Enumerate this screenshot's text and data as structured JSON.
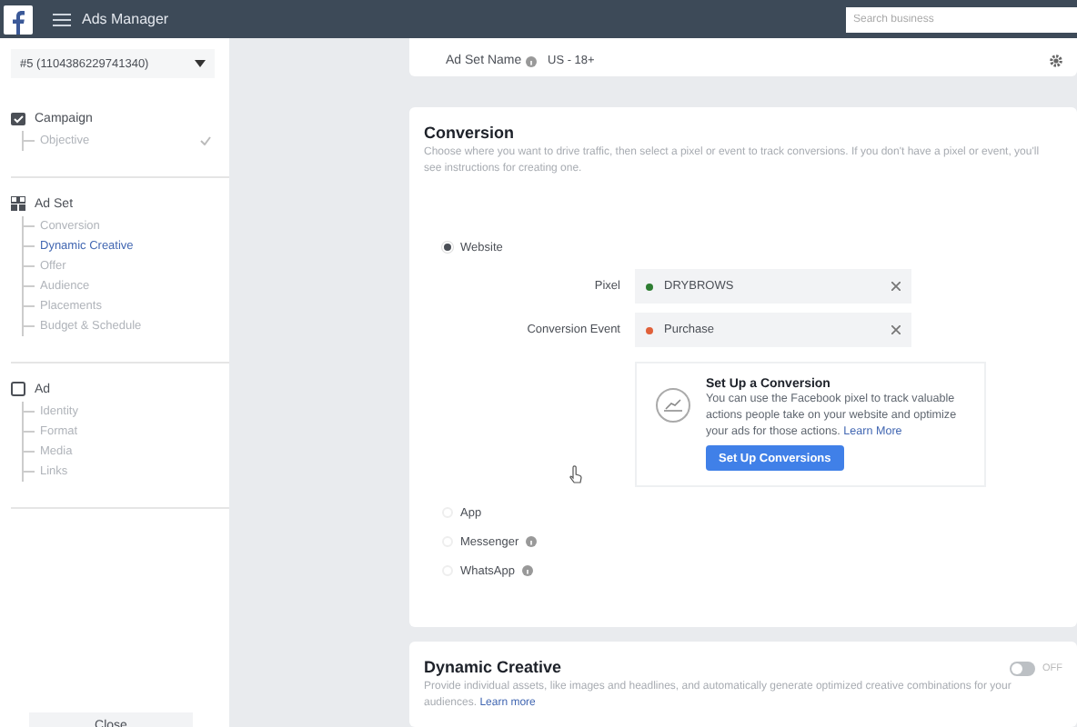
{
  "topbar": {
    "title": "Ads Manager",
    "search": {
      "placeholder": "Search business"
    }
  },
  "sidebar": {
    "account": "#5 (1104386229741340)",
    "sections": [
      {
        "kind": "campaign",
        "label": "Campaign",
        "children": [
          {
            "label": "Objective",
            "selected": false,
            "done": true
          }
        ]
      },
      {
        "kind": "adset",
        "label": "Ad Set",
        "children": [
          {
            "label": "Conversion",
            "selected": false,
            "done": false
          },
          {
            "label": "Dynamic Creative",
            "selected": true,
            "done": false
          },
          {
            "label": "Offer",
            "selected": false,
            "done": false
          },
          {
            "label": "Audience",
            "selected": false,
            "done": false
          },
          {
            "label": "Placements",
            "selected": false,
            "done": false
          },
          {
            "label": "Budget & Schedule",
            "selected": false,
            "done": false
          }
        ]
      },
      {
        "kind": "ad",
        "label": "Ad",
        "children": [
          {
            "label": "Identity",
            "selected": false,
            "done": false
          },
          {
            "label": "Format",
            "selected": false,
            "done": false
          },
          {
            "label": "Media",
            "selected": false,
            "done": false
          },
          {
            "label": "Links",
            "selected": false,
            "done": false
          }
        ]
      }
    ],
    "close": "Close"
  },
  "ad_set_name": {
    "label": "Ad Set Name",
    "value": "US - 18+"
  },
  "conversion": {
    "title": "Conversion",
    "description": "Choose where you want to drive traffic, then select a pixel or event to track conversions. If you don't have a pixel or event, you'll see instructions for creating one.",
    "options": [
      {
        "label": "Website",
        "selected": true,
        "info": false
      },
      {
        "label": "App",
        "selected": false,
        "info": false
      },
      {
        "label": "Messenger",
        "selected": false,
        "info": true
      },
      {
        "label": "WhatsApp",
        "selected": false,
        "info": true
      }
    ],
    "fields": [
      {
        "label": "Pixel",
        "value": "DRYBROWS",
        "color": "#2e7d32"
      },
      {
        "label": "Conversion Event",
        "value": "Purchase",
        "color": "#e0603a"
      }
    ],
    "setup": {
      "title": "Set Up a Conversion",
      "text": "You can use the Facebook pixel to track valuable actions people take on your website and optimize your ads for those actions.",
      "link": "Learn More",
      "button": "Set Up Conversions"
    }
  },
  "dynamic_creative": {
    "title": "Dynamic Creative",
    "description": "Provide individual assets, like images and headlines, and automatically generate optimized creative combinations for your audiences.",
    "link": "Learn more",
    "on": false,
    "state_label": "OFF"
  }
}
